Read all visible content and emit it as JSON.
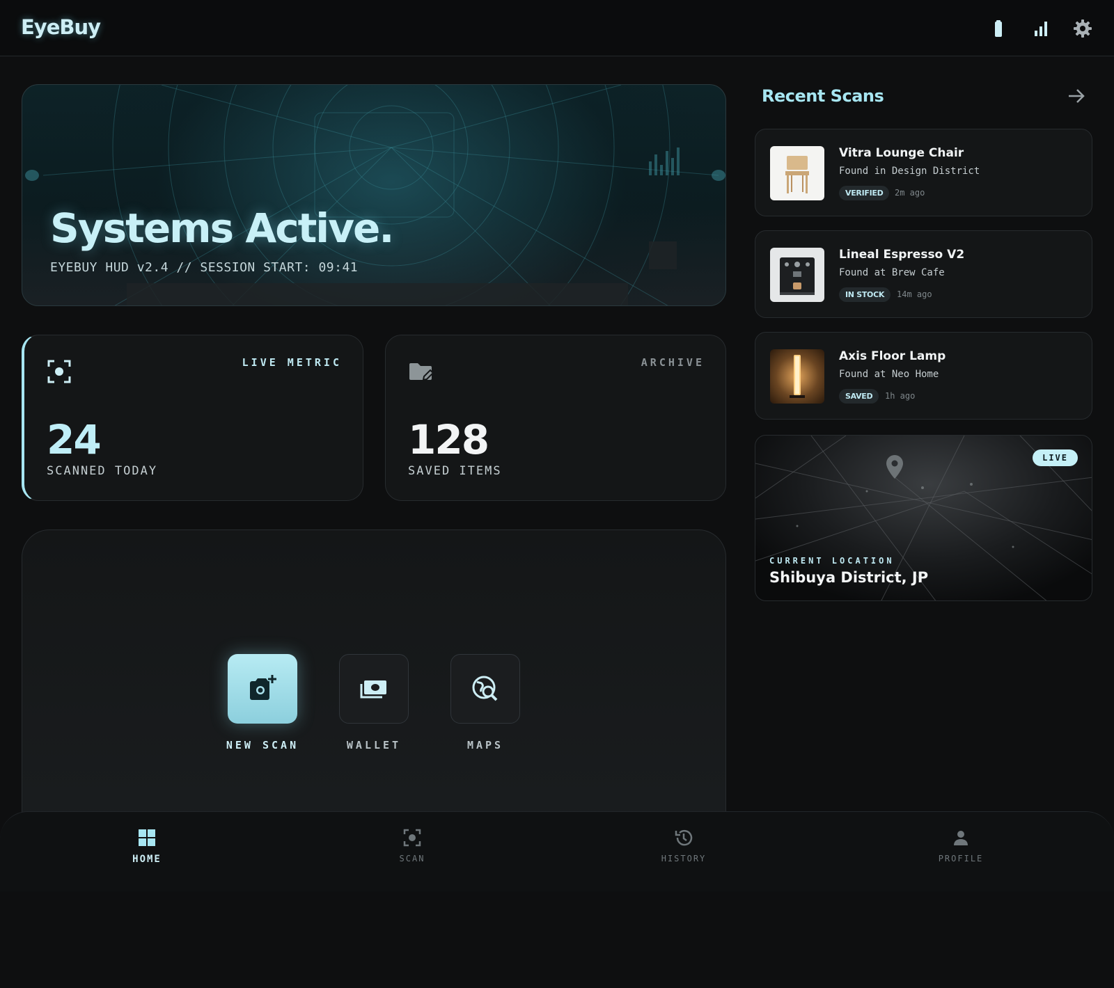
{
  "app": {
    "name": "EyeBuy"
  },
  "header": {
    "icons": [
      "battery-icon",
      "signal-icon",
      "gear-icon"
    ]
  },
  "hero": {
    "title": "Systems Active.",
    "subtitle": "EYEBUY HUD v2.4 // SESSION START: 09:41"
  },
  "stats": [
    {
      "tag": "LIVE METRIC",
      "value": "24",
      "label": "SCANNED TODAY",
      "icon": "scan-focus-icon"
    },
    {
      "tag": "ARCHIVE",
      "value": "128",
      "label": "SAVED ITEMS",
      "icon": "folder-edit-icon"
    }
  ],
  "actions": [
    {
      "label": "NEW SCAN",
      "icon": "camera-plus-icon"
    },
    {
      "label": "WALLET",
      "icon": "wallet-icon"
    },
    {
      "label": "MAPS",
      "icon": "map-search-icon"
    }
  ],
  "recent": {
    "title": "Recent Scans",
    "items": [
      {
        "name": "Vitra Lounge Chair",
        "location": "Found in Design District",
        "badge": "VERIFIED",
        "time": "2m ago"
      },
      {
        "name": "Lineal Espresso V2",
        "location": "Found at Brew Cafe",
        "badge": "IN STOCK",
        "time": "14m ago"
      },
      {
        "name": "Axis Floor Lamp",
        "location": "Found at Neo Home",
        "badge": "SAVED",
        "time": "1h ago"
      }
    ]
  },
  "location": {
    "badge": "LIVE",
    "label": "CURRENT LOCATION",
    "name": "Shibuya District, JP"
  },
  "nav": [
    {
      "label": "HOME",
      "icon": "grid-icon",
      "active": true
    },
    {
      "label": "SCAN",
      "icon": "scan-icon",
      "active": false
    },
    {
      "label": "HISTORY",
      "icon": "history-icon",
      "active": false
    },
    {
      "label": "PROFILE",
      "icon": "person-icon",
      "active": false
    }
  ],
  "colors": {
    "accent": "#a7e6f2",
    "background": "#0e0f10",
    "card": "#141617"
  }
}
